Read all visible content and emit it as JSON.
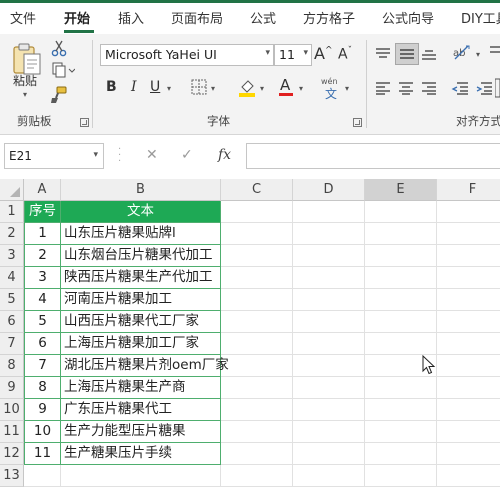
{
  "tabs": [
    "文件",
    "开始",
    "插入",
    "页面布局",
    "公式",
    "方方格子",
    "公式向导",
    "DIY工具"
  ],
  "ribbon": {
    "paste_label": "粘贴",
    "clipboard_group": "剪贴板",
    "font_group": "字体",
    "align_group": "对齐方式",
    "font_name": "Microsoft YaHei UI",
    "font_size": "11",
    "bold": "B",
    "italic": "I",
    "underline": "U",
    "increase_font": "A",
    "decrease_font": "A",
    "phonetic": "wén",
    "font_color_letter": "A"
  },
  "formula_bar": {
    "name_box": "E21",
    "fx": "fx",
    "formula": ""
  },
  "columns": [
    "A",
    "B",
    "C",
    "D",
    "E",
    "F"
  ],
  "rows": [
    "1",
    "2",
    "3",
    "4",
    "5",
    "6",
    "7",
    "8",
    "9",
    "10",
    "11",
    "12",
    "13"
  ],
  "table": {
    "header": [
      "序号",
      "文本"
    ],
    "data": [
      [
        "1",
        "山东压片糖果贴牌l"
      ],
      [
        "2",
        "山东烟台压片糖果代加工"
      ],
      [
        "3",
        "陕西压片糖果生产代加工"
      ],
      [
        "4",
        "河南压片糖果加工"
      ],
      [
        "5",
        "山西压片糖果代工厂家"
      ],
      [
        "6",
        "上海压片糖果加工厂家"
      ],
      [
        "7",
        "湖北压片糖果片剂oem厂家"
      ],
      [
        "8",
        "上海压片糖果生产商"
      ],
      [
        "9",
        "广东压片糖果代工"
      ],
      [
        "10",
        "生产力能型压片糖果"
      ],
      [
        "11",
        "生产糖果压片手续"
      ]
    ]
  },
  "colors": {
    "accent": "#217346",
    "header_fill": "#1ea955",
    "cell_border": "#4eae6e",
    "font_color": "#e02020",
    "fill_color": "#ffd700"
  }
}
